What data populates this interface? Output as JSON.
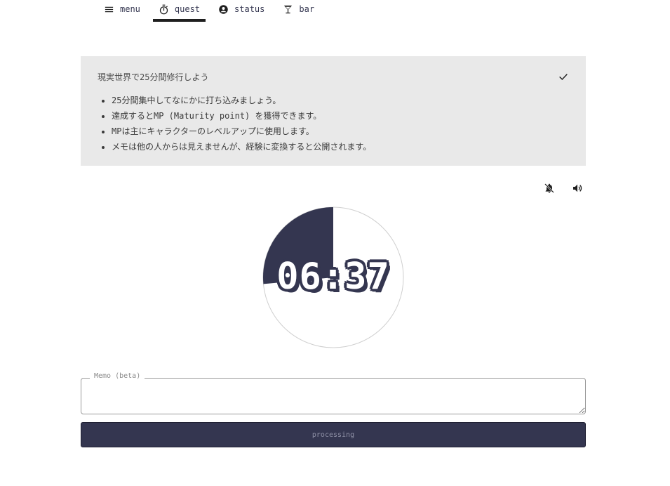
{
  "nav": {
    "items": [
      {
        "label": "menu",
        "icon": "hamburger-menu-icon"
      },
      {
        "label": "quest",
        "icon": "stopwatch-icon",
        "active": true
      },
      {
        "label": "status",
        "icon": "account-circle-icon"
      },
      {
        "label": "bar",
        "icon": "cocktail-glass-icon"
      }
    ]
  },
  "panel": {
    "title": "現実世界で25分間修行しよう",
    "icon": "check-icon",
    "bullets": [
      "25分間集中してなにかに打ち込みましょう。",
      "達成するとMP (Maturity point) を獲得できます。",
      "MPは主にキャラクターのレベルアップに使用します。",
      "メモは他の人からは見えませんが、経験に変換すると公開されます。"
    ]
  },
  "controls": {
    "notify_icon": "bell-off-icon",
    "sound_icon": "volume-up-icon"
  },
  "timer": {
    "display": "06:37",
    "progress_fraction": 0.265,
    "colors": {
      "fill": "#343650",
      "track": "#ffffff",
      "outline": "#cfcfcf"
    }
  },
  "memo": {
    "label": "Memo (beta)",
    "value": ""
  },
  "action_button": {
    "label": "processing"
  }
}
